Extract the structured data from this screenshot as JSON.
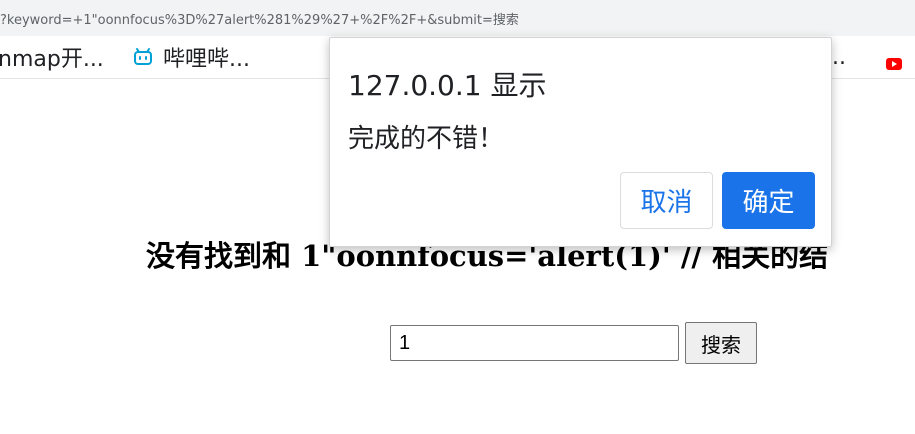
{
  "browser": {
    "url": "?keyword=+1\"oonnfocus%3D%27alert%281%29%27+%2F%2F+&submit=搜索",
    "bookmarks": [
      {
        "label": "nmap开...",
        "icon": ""
      },
      {
        "label": "哔哩哔...",
        "icon": "bilibili-icon"
      },
      {
        "label": "..",
        "icon": ""
      },
      {
        "label": "",
        "icon": "youtube-icon"
      }
    ]
  },
  "page": {
    "heading": "没有找到和 1\"oonnfocus='alert(1)' // 相关的结",
    "search": {
      "value": "1",
      "button_label": "搜索"
    }
  },
  "dialog": {
    "title": "127.0.0.1 显示",
    "message": "完成的不错！",
    "cancel_label": "取消",
    "ok_label": "确定"
  },
  "colors": {
    "accent": "#1a73e8",
    "youtube": "#ff0000",
    "bilibili": "#00a1d6"
  }
}
